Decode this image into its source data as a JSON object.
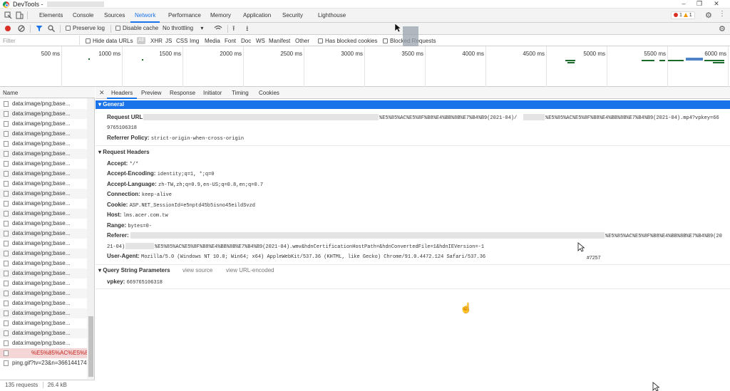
{
  "window": {
    "title": "DevTools -"
  },
  "panel_tabs": [
    "Elements",
    "Console",
    "Sources",
    "Network",
    "Performance",
    "Memory",
    "Application",
    "Security",
    "Lighthouse"
  ],
  "badges": {
    "errors": "1",
    "warnings": "1"
  },
  "toolbar": {
    "preserve_log": "Preserve log",
    "disable_cache": "Disable cache",
    "throttling": "No throttling"
  },
  "filter": {
    "placeholder": "Filter",
    "hide_data_urls": "Hide data URLs",
    "types": [
      "All",
      "XHR",
      "JS",
      "CSS",
      "Img",
      "Media",
      "Font",
      "Doc",
      "WS",
      "Manifest",
      "Other"
    ],
    "has_blocked_cookies": "Has blocked cookies",
    "blocked_requests": "Blocked Requests"
  },
  "timeline": {
    "ticks": [
      "500 ms",
      "1000 ms",
      "1500 ms",
      "2000 ms",
      "2500 ms",
      "3000 ms",
      "3500 ms",
      "4000 ms",
      "4500 ms",
      "5000 ms",
      "5500 ms",
      "6000 ms"
    ]
  },
  "request_list": {
    "header": "Name",
    "items": [
      "data:image/png;base...",
      "data:image/png;base...",
      "data:image/png;base...",
      "data:image/png;base...",
      "data:image/png;base...",
      "data:image/png;base...",
      "data:image/png;base...",
      "data:image/png;base...",
      "data:image/png;base...",
      "data:image/png;base...",
      "data:image/png;base...",
      "data:image/png;base...",
      "data:image/png;base...",
      "data:image/png;base...",
      "data:image/png;base...",
      "data:image/png;base...",
      "data:image/png;base...",
      "data:image/png;base...",
      "data:image/png;base...",
      "data:image/png;base...",
      "data:image/png;base...",
      "data:image/png;base...",
      "data:image/png;base...",
      "data:image/png;base...",
      "data:image/png;base...",
      "%E5%85%AC%E5%8F",
      "ping.gif?tv=23&n=366144174"
    ],
    "status_requests": "135 requests",
    "status_transferred": "26.4 kB transferred"
  },
  "detail_tabs": [
    "Headers",
    "Preview",
    "Response",
    "Initiator",
    "Timing",
    "Cookies"
  ],
  "general": {
    "title": "General",
    "request_url_label": "Request URL:",
    "request_url_part1": "%E5%85%AC%E5%8F%B8%E4%BB%8B%E7%B4%B9(2021-04)/",
    "request_url_part2": "%E5%85%AC%E5%8F%B8%E4%BB%8B%E7%B4%B9(2021-04).mp4?vpkey=66",
    "request_url_part3": "9765106318",
    "referrer_policy_label": "Referrer Policy:",
    "referrer_policy_value": "strict-origin-when-cross-origin"
  },
  "request_headers": {
    "title": "Request Headers",
    "accept_label": "Accept:",
    "accept_value": "*/*",
    "accept_encoding_label": "Accept-Encoding:",
    "accept_encoding_value": "identity;q=1, *;q=0",
    "accept_language_label": "Accept-Language:",
    "accept_language_value": "zh-TW,zh;q=0.9,en-US;q=0.8,en;q=0.7",
    "connection_label": "Connection:",
    "connection_value": "keep-alive",
    "cookie_label": "Cookie:",
    "cookie_value": "ASP.NET_SessionId=e5nptd45b5isno45eildSvzd",
    "host_label": "Host:",
    "host_value": "lms.acer.com.tw",
    "range_label": "Range:",
    "range_value": "bytes=0-",
    "referer_label": "Referer:",
    "referer_part1": "%E5%85%AC%E5%8F%B8%E4%BB%8B%E7%B4%B9(20",
    "referer_part2": "21-04)",
    "referer_part3": "%E5%85%AC%E5%8F%B8%E4%BB%8B%E7%B4%B9(2021-04).wmv&hdnCertificationHostPath=&hdnConvertedFile=1&hdnIEVersion=-1",
    "user_agent_label": "User-Agent:",
    "user_agent_value": "Mozilla/5.0 (Windows NT 10.0; Win64; x64) AppleWebKit/537.36 (KHTML, like Gecko) Chrome/91.0.4472.124 Safari/537.36"
  },
  "query_string": {
    "title": "Query String Parameters",
    "view_source": "view source",
    "view_url_encoded": "view URL-encoded",
    "vpkey_label": "vpkey:",
    "vpkey_value": "669765106318"
  },
  "annotation": "#7257"
}
